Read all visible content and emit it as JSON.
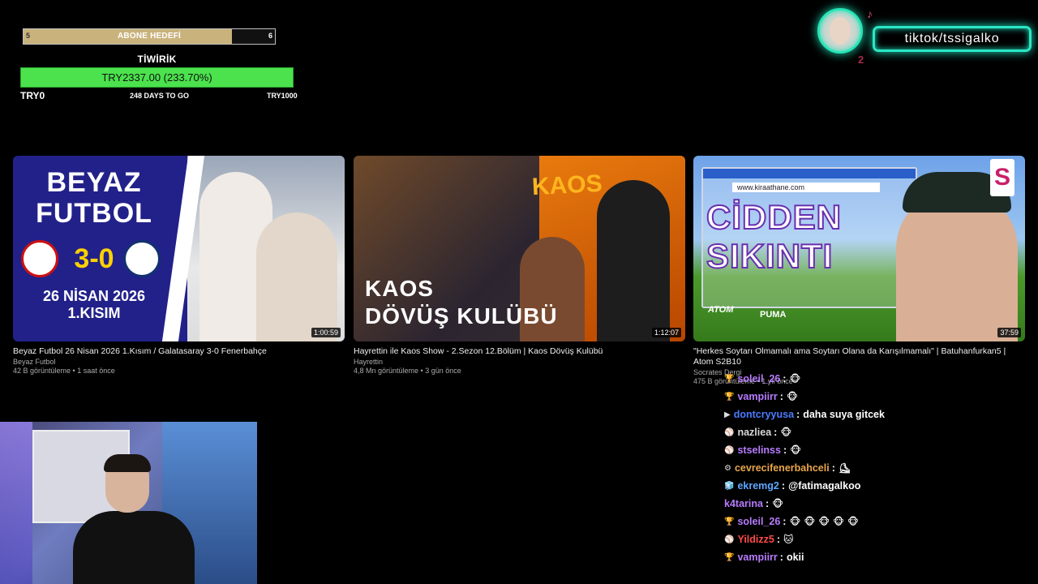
{
  "sub_goal": {
    "start": "5",
    "label": "ABONE HEDEFİ",
    "end": "6",
    "progress": 0.83
  },
  "donation_goal": {
    "title": "TİWİRİK",
    "amount": "TRY2337.00 (233.70%)",
    "start": "TRY0",
    "days": "248 DAYS TO GO",
    "target": "TRY1000"
  },
  "tiktok": {
    "handle": "tiktok/tssigalko",
    "number": "2",
    "note_icon": "music-note-icon",
    "accent": "#2ae8c4"
  },
  "videos": [
    {
      "title": "Beyaz Futbol 26 Nisan 2026 1.Kısım / Galatasaray 3-0 Fenerbahçe",
      "channel": "Beyaz Futbol",
      "meta": "42 B görüntüleme • 1 saat önce",
      "duration": "1:00:59",
      "thumb": {
        "line1": "BEYAZ",
        "line2": "FUTBOL",
        "score": "3-0",
        "date1": "26 NİSAN 2026",
        "date2": "1.KISIM"
      }
    },
    {
      "title": "Hayrettin ile Kaos Show - 2.Sezon 12.Bölüm | Kaos Dövüş Kulübü",
      "channel": "Hayrettin",
      "meta": "4,8 Mn görüntüleme • 3 gün önce",
      "duration": "1:12:07",
      "thumb": {
        "brand": "KAOS",
        "line1": "KAOS",
        "line2": "DÖVÜŞ KULÜBÜ"
      }
    },
    {
      "title": "\"Herkes Soytarı Olmamalı ama Soytarı Olana da Karışılmamalı\" | Batuhanfurkan5 | Atom S2B10",
      "channel": "Socrates Dergi",
      "meta": "475 B görüntüleme • 1 yıl önce",
      "duration": "37:59",
      "thumb": {
        "url": "www.kiraathane.com",
        "line1": "CİDDEN",
        "line2": "SIKINTI",
        "logo": "S",
        "brand1": "ATOM",
        "brand2": "PUMA"
      }
    }
  ],
  "chat": [
    {
      "badge": "🏆",
      "user": "soleil_26",
      "color": "#b87cff",
      "message": "",
      "emotes": [
        "🐵"
      ]
    },
    {
      "badge": "🏆",
      "user": "vampiirr",
      "color": "#b87cff",
      "message": "",
      "emotes": [
        "🐵"
      ]
    },
    {
      "badge": "▶",
      "user": "dontcryyusa",
      "color": "#4a7cff",
      "message": "daha suya gitcek",
      "emotes": []
    },
    {
      "badge": "⚾",
      "user": "nazliea",
      "color": "#d9d9d9",
      "message": "",
      "emotes": [
        "🐵"
      ]
    },
    {
      "badge": "⚾",
      "user": "stselinss",
      "color": "#b87cff",
      "message": "",
      "emotes": [
        "🐵"
      ]
    },
    {
      "badge": "⚙",
      "user": "cevrecifenerbahceli",
      "color": "#e8a64a",
      "message": "",
      "emotes": [
        "⛸"
      ]
    },
    {
      "badge": "🧊",
      "user": "ekremg2",
      "color": "#5da8ff",
      "message": "@fatimagalkoo",
      "emotes": []
    },
    {
      "badge": "",
      "user": "k4tarina",
      "color": "#b87cff",
      "message": "",
      "emotes": [
        "🐵"
      ]
    },
    {
      "badge": "🏆",
      "user": "soleil_26",
      "color": "#b87cff",
      "message": "",
      "emotes": [
        "🐵",
        "🐵",
        "🐵",
        "🐵",
        "🐵"
      ]
    },
    {
      "badge": "⚾",
      "user": "Yildizz5",
      "color": "#ff4a4a",
      "message": "",
      "emotes": [
        "🐱"
      ]
    },
    {
      "badge": "🏆",
      "user": "vampiirr",
      "color": "#b87cff",
      "message": "okii",
      "emotes": []
    }
  ]
}
